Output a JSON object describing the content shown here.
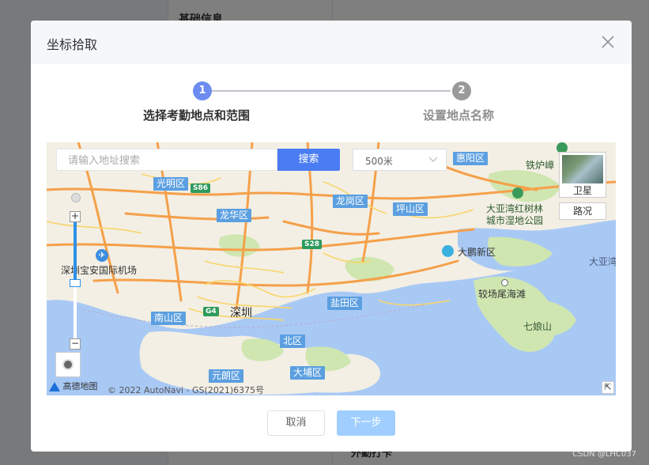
{
  "background": {
    "section_title": "基础信息",
    "bottom_label": "外勤打卡"
  },
  "watermark": "CSDN @LHC037",
  "dialog": {
    "title": "坐标拾取",
    "close_icon": "close-icon"
  },
  "steps": [
    {
      "number": "1",
      "label": "选择考勤地点和范围",
      "status": "active",
      "color": "#6c8cf0"
    },
    {
      "number": "2",
      "label": "设置地点名称",
      "status": "pending",
      "color": "#9a9a9a"
    }
  ],
  "map": {
    "search_placeholder": "请输入地址搜索",
    "search_button": "搜索",
    "radius_value": "500米",
    "layers": {
      "satellite": "卫星",
      "road": "路况"
    },
    "districts": [
      "光明区",
      "龙华区",
      "龙岗区",
      "坪山区",
      "惠阳区",
      "南山区",
      "盐田区",
      "北区",
      "元朗区",
      "大埔区"
    ],
    "places": {
      "airport": "深圳宝安国际机场",
      "city": "深圳",
      "dapeng": "大鹏新区",
      "mangrove_1": "大亚湾红树林",
      "mangrove_2": "城市湿地公园",
      "tiekuzhang": "铁炉嶂",
      "jiaoweiha": "较场尾海滩",
      "qiniang": "七娘山",
      "daya": "大亚湾"
    },
    "road_shields": [
      "S86",
      "G4",
      "S28"
    ],
    "logo": "高德地图",
    "copyright": "© 2022 AutoNavi - GS(2021)6375号",
    "water_color": "#a9c9f5",
    "land_color": "#f3efe4",
    "green_color": "#cfe6b0"
  },
  "footer": {
    "cancel": "取消",
    "next": "下一步"
  }
}
